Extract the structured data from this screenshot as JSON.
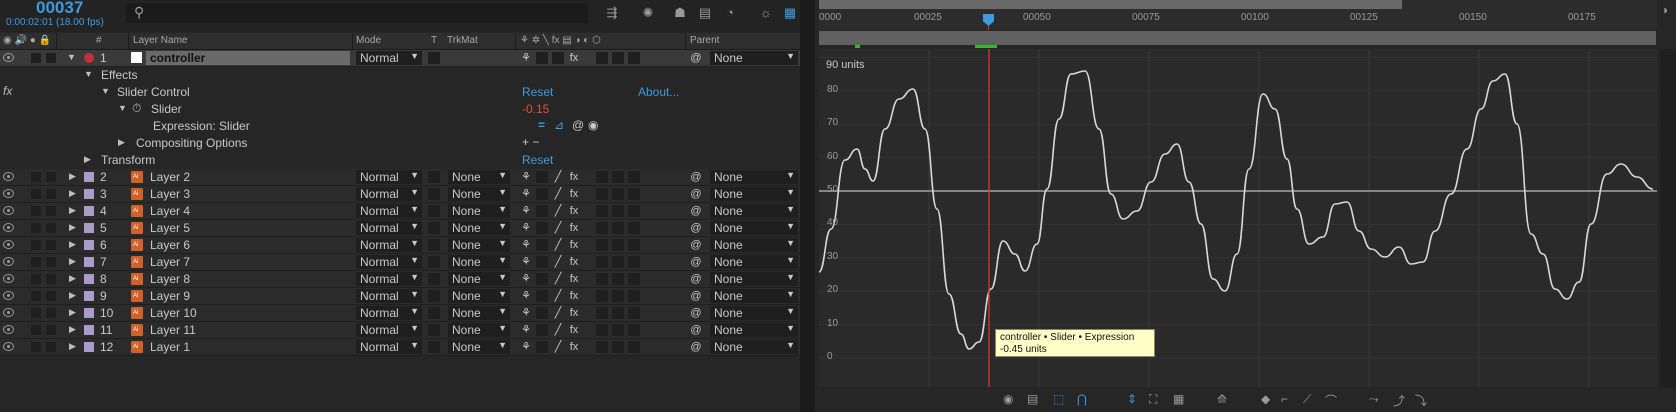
{
  "header": {
    "timecode": "00037",
    "fps_info": "0:00:02:01 (18.00 fps)"
  },
  "columns": {
    "layer_name": "Layer Name",
    "mode": "Mode",
    "t": "T",
    "trkmat": "TrkMat",
    "parent": "Parent",
    "hash": "#"
  },
  "controller": {
    "num": "1",
    "name": "controller",
    "mode": "Normal",
    "parent": "None",
    "effects_label": "Effects",
    "slider_control": "Slider Control",
    "reset": "Reset",
    "about": "About...",
    "slider": "Slider",
    "slider_value": "-0.15",
    "expression_label": "Expression: Slider",
    "compositing": "Compositing Options",
    "transform": "Transform",
    "transform_reset": "Reset",
    "fx_glyph": "fx",
    "plusminus": "+ −"
  },
  "layers": [
    {
      "num": "2",
      "name": "Layer 2",
      "mode": "Normal",
      "trkmat": "None",
      "parent": "None"
    },
    {
      "num": "3",
      "name": "Layer 3",
      "mode": "Normal",
      "trkmat": "None",
      "parent": "None"
    },
    {
      "num": "4",
      "name": "Layer 4",
      "mode": "Normal",
      "trkmat": "None",
      "parent": "None"
    },
    {
      "num": "5",
      "name": "Layer 5",
      "mode": "Normal",
      "trkmat": "None",
      "parent": "None"
    },
    {
      "num": "6",
      "name": "Layer 6",
      "mode": "Normal",
      "trkmat": "None",
      "parent": "None"
    },
    {
      "num": "7",
      "name": "Layer 7",
      "mode": "Normal",
      "trkmat": "None",
      "parent": "None"
    },
    {
      "num": "8",
      "name": "Layer 8",
      "mode": "Normal",
      "trkmat": "None",
      "parent": "None"
    },
    {
      "num": "9",
      "name": "Layer 9",
      "mode": "Normal",
      "trkmat": "None",
      "parent": "None"
    },
    {
      "num": "10",
      "name": "Layer 10",
      "mode": "Normal",
      "trkmat": "None",
      "parent": "None"
    },
    {
      "num": "11",
      "name": "Layer 11",
      "mode": "Normal",
      "trkmat": "None",
      "parent": "None"
    },
    {
      "num": "12",
      "name": "Layer 1",
      "mode": "Normal",
      "trkmat": "None",
      "parent": "None"
    }
  ],
  "timeline": {
    "ruler_labels": [
      "0000",
      "00025",
      "00050",
      "00075",
      "00100",
      "00125",
      "00150",
      "00175"
    ],
    "current_frame": 37
  },
  "graph": {
    "units_label": "90 units",
    "y_labels": [
      "80",
      "70",
      "60",
      "50",
      "40",
      "30",
      "20",
      "10",
      "0"
    ],
    "tooltip_line1": "controller • Slider  • Expression",
    "tooltip_line2": "-0.45 units"
  },
  "colors": {
    "accent_blue": "#3d9be0",
    "value_red": "#e0503c",
    "controller_swatch": "#c0303a",
    "layer_swatch": "#a89cc8",
    "curve": "#d8d8d8",
    "playhead": "#e03030",
    "tooltip_bg": "#ffffc8"
  }
}
